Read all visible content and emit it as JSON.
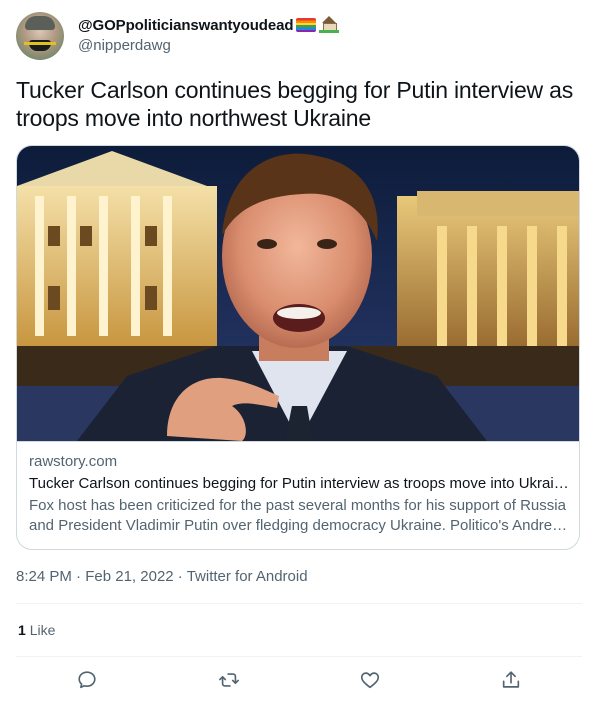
{
  "user": {
    "display_name": "@GOPpoliticianswantyoudead",
    "handle": "@nipperdawg",
    "avatar_icon": "user-avatar",
    "badges": [
      "rainbow-flag-icon",
      "house-with-garden-icon"
    ]
  },
  "tweet": {
    "text": "Tucker Carlson continues begging for Putin interview as troops move into northwest Ukraine"
  },
  "card": {
    "domain": "rawstory.com",
    "title": "Tucker Carlson continues begging for Putin interview as troops move into Ukraine as troops move into northwest Ukraine",
    "description": "Fox host has been criticized for the past several months for his support of Russia and President Vladimir Putin over fledging democracy Ukraine. Politico's Andrew Desiderio reported that Carlson had",
    "image_icon": "news-photo"
  },
  "meta": {
    "time": "8:24 PM",
    "separator": " · ",
    "date": "Feb 21, 2022",
    "source": "Twitter for Android"
  },
  "engagement": {
    "like_count": "1",
    "like_label": "Like"
  },
  "actions": [
    "reply-icon",
    "retweet-icon",
    "like-icon",
    "share-icon"
  ],
  "colors": {
    "text": "#0f1419",
    "secondary": "#536471",
    "border": "#cfd9de",
    "divider": "#eff3f4"
  }
}
